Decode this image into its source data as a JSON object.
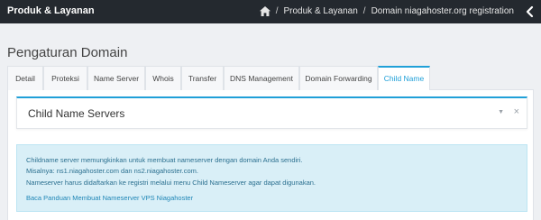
{
  "topbar": {
    "title": "Produk & Layanan",
    "breadcrumb": {
      "home_icon": "home-icon",
      "separator": "/",
      "items": [
        "Produk & Layanan",
        "Domain niagahoster.org registration"
      ]
    },
    "back_icon": "chevron-left-icon"
  },
  "page": {
    "title": "Pengaturan Domain"
  },
  "tabs": [
    {
      "label": "Detail",
      "active": false
    },
    {
      "label": "Proteksi",
      "active": false
    },
    {
      "label": "Name Server",
      "active": false
    },
    {
      "label": "Whois",
      "active": false
    },
    {
      "label": "Transfer",
      "active": false
    },
    {
      "label": "DNS Management",
      "active": false
    },
    {
      "label": "Domain Forwarding",
      "active": false
    },
    {
      "label": "Child Name",
      "active": true
    }
  ],
  "box": {
    "title": "Child Name Servers",
    "collapse_icon": "caret-down-icon",
    "close_icon": "close-icon",
    "close_glyph": "×",
    "collapse_glyph": "▼"
  },
  "alert": {
    "lines": [
      "Childname server memungkinkan untuk membuat nameserver dengan domain Anda sendiri.",
      "Misalnya: ns1.niagahoster.com dan ns2.niagahoster.com.",
      "Nameserver harus didaftarkan ke registri melalui menu Child Nameserver agar dapat digunakan."
    ],
    "link": "Baca Panduan Membuat Nameserver VPS Niagahoster"
  },
  "colors": {
    "accent": "#20a0d8",
    "topbar": "#24292f",
    "alert_bg": "#d9eff7",
    "alert_text": "#2a6f8f"
  }
}
